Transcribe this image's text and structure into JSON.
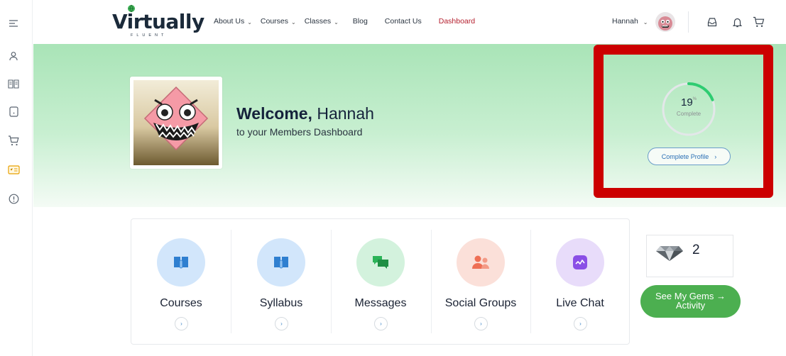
{
  "brand": {
    "logo_text": "Virtually",
    "logo_sub": "FLUENT"
  },
  "nav": {
    "items": [
      {
        "label": "About Us",
        "has_caret": true
      },
      {
        "label": "Courses",
        "has_caret": true
      },
      {
        "label": "Classes",
        "has_caret": true
      },
      {
        "label": "Blog",
        "has_caret": false
      },
      {
        "label": "Contact Us",
        "has_caret": false
      },
      {
        "label": "Dashboard",
        "has_caret": false,
        "active": true
      }
    ],
    "active_color": "#b41e2d"
  },
  "user": {
    "name": "Hannah"
  },
  "header_icons": [
    "inbox-icon",
    "bell-icon",
    "cart-icon"
  ],
  "sidebar_icons": [
    "menu-icon",
    "user-icon",
    "book-icon",
    "document-icon",
    "cart-icon",
    "id-card-icon",
    "info-icon"
  ],
  "hero": {
    "welcome_bold": "Welcome,",
    "welcome_name": "Hannah",
    "subtitle": "to your Members Dashboard"
  },
  "profile_progress": {
    "percent": 19,
    "percent_text": "19",
    "percent_sign": "%",
    "label": "Complete",
    "button": "Complete Profile",
    "accent": "#2ecc71"
  },
  "tiles": [
    {
      "label": "Courses",
      "icon": "book-icon",
      "bg": "#d2e6fb",
      "fg": "#2f7fd0"
    },
    {
      "label": "Syllabus",
      "icon": "book-icon",
      "bg": "#d2e6fb",
      "fg": "#2f7fd0"
    },
    {
      "label": "Messages",
      "icon": "chat-icon",
      "bg": "#d3f2dd",
      "fg": "#2bb358"
    },
    {
      "label": "Social Groups",
      "icon": "users-icon",
      "bg": "#fbe0d9",
      "fg": "#ee6f55"
    },
    {
      "label": "Live Chat",
      "icon": "activity-icon",
      "bg": "#e8dcfa",
      "fg": "#8a4fe6"
    }
  ],
  "gems": {
    "count": "2",
    "button_line1": "See My Gems →",
    "button_line2": "Activity",
    "button_color": "#4caf50"
  },
  "colors": {
    "hero_green": "#a9e4b7",
    "highlight_red": "#cc0000"
  }
}
